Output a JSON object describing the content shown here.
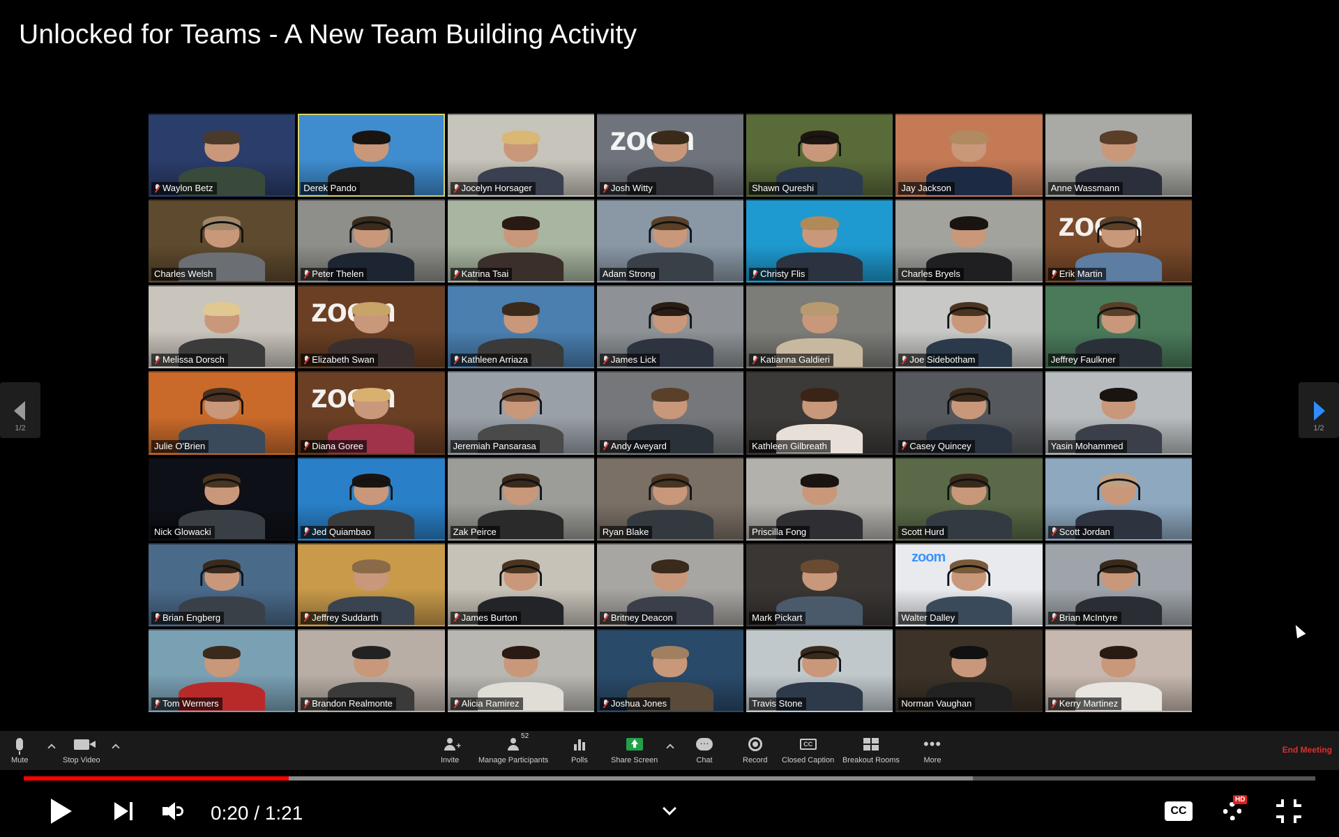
{
  "video": {
    "title": "Unlocked for Teams - A New Team Building Activity"
  },
  "gallery": {
    "participants": [
      {
        "name": "Waylon Betz",
        "muted": true,
        "bg": "#2b3d6b",
        "shirt": "#3a4a3a",
        "hair": "#4a3a2a",
        "headset": false
      },
      {
        "name": "Derek Pando",
        "muted": false,
        "bg": "#3f8ccf",
        "shirt": "#222222",
        "hair": "#1a1410",
        "headset": false,
        "active": true
      },
      {
        "name": "Jocelyn Horsager",
        "muted": true,
        "bg": "#c7c4bb",
        "shirt": "#3a4050",
        "hair": "#d9b774",
        "headset": false
      },
      {
        "name": "Josh Witty",
        "muted": true,
        "bg": "#6f747c",
        "shirt": "#2e3036",
        "hair": "#3a2a1a",
        "headset": false,
        "zoom_text": "zoom"
      },
      {
        "name": "Shawn Qureshi",
        "muted": false,
        "bg": "#5a6b3a",
        "shirt": "#2b3a4f",
        "hair": "#1f1510",
        "headset": true
      },
      {
        "name": "Jay Jackson",
        "muted": false,
        "bg": "#c47a55",
        "shirt": "#1d2a44",
        "hair": "#b08a60",
        "headset": false
      },
      {
        "name": "Anne Wassmann",
        "muted": false,
        "bg": "#a9aaa5",
        "shirt": "#2a2f3b",
        "hair": "#5a3e28",
        "headset": false
      },
      {
        "name": "Charles Welsh",
        "muted": false,
        "bg": "#5e4a2e",
        "shirt": "#6b6e72",
        "hair": "#a08768",
        "headset": true
      },
      {
        "name": "Peter Thelen",
        "muted": true,
        "bg": "#8e8e8a",
        "shirt": "#1d2533",
        "hair": "#3a2b1c",
        "headset": true
      },
      {
        "name": "Katrina Tsai",
        "muted": true,
        "bg": "#a8b5a0",
        "shirt": "#3a2f2a",
        "hair": "#2a1a14",
        "headset": false
      },
      {
        "name": "Adam Strong",
        "muted": false,
        "bg": "#8a98a6",
        "shirt": "#3a4048",
        "hair": "#5a4028",
        "headset": true
      },
      {
        "name": "Christy Flis",
        "muted": true,
        "bg": "#1e9ad0",
        "shirt": "#2b3340",
        "hair": "#b08a58",
        "headset": false
      },
      {
        "name": "Charles Bryels",
        "muted": false,
        "bg": "#a3a39e",
        "shirt": "#1f1f22",
        "hair": "#1a1410",
        "headset": false
      },
      {
        "name": "Erik Martin",
        "muted": true,
        "bg": "#7a4a2a",
        "shirt": "#5d7da3",
        "hair": "#5a4028",
        "headset": true,
        "zoom_text": "zoom"
      },
      {
        "name": "Melissa Dorsch",
        "muted": true,
        "bg": "#c9c4bc",
        "shirt": "#3b3b3b",
        "hair": "#e0c890",
        "headset": false
      },
      {
        "name": "Elizabeth Swan",
        "muted": true,
        "bg": "#6a3f24",
        "shirt": "#3a2f2f",
        "hair": "#c9a468",
        "headset": false,
        "zoom_text": "zoom"
      },
      {
        "name": "Kathleen Arriaza",
        "muted": true,
        "bg": "#4a7fb0",
        "shirt": "#3a3a3a",
        "hair": "#3a2a1c",
        "headset": false
      },
      {
        "name": "James Lick",
        "muted": true,
        "bg": "#8e9296",
        "shirt": "#2d3440",
        "hair": "#2a1d14",
        "headset": true
      },
      {
        "name": "Katianna Galdieri",
        "muted": true,
        "bg": "#7c7c78",
        "shirt": "#c8b8a0",
        "hair": "#b89a70",
        "headset": false
      },
      {
        "name": "Joe Sidebotham",
        "muted": true,
        "bg": "#c8c8c6",
        "shirt": "#2a3a4a",
        "hair": "#4a3520",
        "headset": true
      },
      {
        "name": "Jeffrey Faulkner",
        "muted": false,
        "bg": "#4a7a5a",
        "shirt": "#2a3038",
        "hair": "#5a4028",
        "headset": true
      },
      {
        "name": "Julie O'Brien",
        "muted": false,
        "bg": "#c96a2a",
        "shirt": "#3a4a5a",
        "hair": "#4a3020",
        "headset": true
      },
      {
        "name": "Diana Goree",
        "muted": true,
        "bg": "#6a3f24",
        "shirt": "#a0324a",
        "hair": "#d8b070",
        "headset": false,
        "zoom_text": "zoom"
      },
      {
        "name": "Jeremiah Pansarasa",
        "muted": false,
        "bg": "#9aa0a8",
        "shirt": "#4a4a4a",
        "hair": "#6a4a30",
        "headset": true
      },
      {
        "name": "Andy Aveyard",
        "muted": true,
        "bg": "#75777a",
        "shirt": "#2b3138",
        "hair": "#5a4028",
        "headset": false
      },
      {
        "name": "Kathleen Gilbreath",
        "muted": false,
        "bg": "#3c3a38",
        "shirt": "#e8e0d8",
        "hair": "#3a2416",
        "headset": false
      },
      {
        "name": "Casey Quincey",
        "muted": true,
        "bg": "#55585c",
        "shirt": "#2a3440",
        "hair": "#3a2a1c",
        "headset": true
      },
      {
        "name": "Yasin Mohammed",
        "muted": false,
        "bg": "#b8bcbe",
        "shirt": "#3a3f4a",
        "hair": "#1a1410",
        "headset": false
      },
      {
        "name": "Nick Glowacki",
        "muted": false,
        "bg": "#0e1018",
        "shirt": "#3a3f46",
        "hair": "#4a3520",
        "headset": true
      },
      {
        "name": "Jed Quiambao",
        "muted": true,
        "bg": "#2a80c8",
        "shirt": "#3a3a3a",
        "hair": "#1a1410",
        "headset": true
      },
      {
        "name": "Zak Peirce",
        "muted": false,
        "bg": "#9c9c98",
        "shirt": "#2a2a2a",
        "hair": "#3a2a1c",
        "headset": true
      },
      {
        "name": "Ryan Blake",
        "muted": false,
        "bg": "#7b7066",
        "shirt": "#33393f",
        "hair": "#4a3520",
        "headset": true
      },
      {
        "name": "Priscilla Fong",
        "muted": false,
        "bg": "#b3b1ac",
        "shirt": "#2f2f33",
        "hair": "#1a1410",
        "headset": false
      },
      {
        "name": "Scott Hurd",
        "muted": false,
        "bg": "#5a6a48",
        "shirt": "#333a42",
        "hair": "#3a2a1c",
        "headset": true
      },
      {
        "name": "Scott Jordan",
        "muted": true,
        "bg": "#8ea8c0",
        "shirt": "#2d3440",
        "hair": "#c0a080",
        "headset": true
      },
      {
        "name": "Brian Engberg",
        "muted": true,
        "bg": "#4a6a8a",
        "shirt": "#3a4048",
        "hair": "#3a2a1c",
        "headset": true
      },
      {
        "name": "Jeffrey Suddarth",
        "muted": true,
        "bg": "#c89a4a",
        "shirt": "#3a4450",
        "hair": "#8a6a48",
        "headset": false
      },
      {
        "name": "James Burton",
        "muted": true,
        "bg": "#c7c2b8",
        "shirt": "#222428",
        "hair": "#4a3520",
        "headset": true
      },
      {
        "name": "Britney Deacon",
        "muted": true,
        "bg": "#a8a6a2",
        "shirt": "#3a3f4a",
        "hair": "#3a2a1c",
        "headset": false
      },
      {
        "name": "Mark Pickart",
        "muted": false,
        "bg": "#3a3634",
        "shirt": "#4a5a6a",
        "hair": "#6a4a30",
        "headset": false
      },
      {
        "name": "Walter Dalley",
        "muted": false,
        "bg": "#e8eaee",
        "shirt": "#3a4a5a",
        "hair": "#7a5a38",
        "headset": true,
        "zoom_text_small": "zoom"
      },
      {
        "name": "Brian McIntyre",
        "muted": true,
        "bg": "#9ea4aa",
        "shirt": "#2a2e34",
        "hair": "#3a2a1c",
        "headset": true
      },
      {
        "name": "Tom Wermers",
        "muted": true,
        "bg": "#7aa0b4",
        "shirt": "#b82a2a",
        "hair": "#3a2a1c",
        "headset": false
      },
      {
        "name": "Brandon Realmonte",
        "muted": true,
        "bg": "#b8aea6",
        "shirt": "#3a3a3a",
        "hair": "#222222",
        "headset": false
      },
      {
        "name": "Alicia Ramirez",
        "muted": true,
        "bg": "#b9b7b2",
        "shirt": "#e0dcd6",
        "hair": "#2a1a14",
        "headset": false
      },
      {
        "name": "Joshua Jones",
        "muted": true,
        "bg": "#2a4a6a",
        "shirt": "#5a4a3a",
        "hair": "#a08060",
        "headset": false
      },
      {
        "name": "Travis Stone",
        "muted": false,
        "bg": "#c0c8cc",
        "shirt": "#2e3a4a",
        "hair": "#3a2a1c",
        "headset": true
      },
      {
        "name": "Norman Vaughan",
        "muted": false,
        "bg": "#3c3228",
        "shirt": "#222222",
        "hair": "#111111",
        "headset": false
      },
      {
        "name": "Kerry Martinez",
        "muted": true,
        "bg": "#c6b8ae",
        "shirt": "#e8e4e0",
        "hair": "#2a1a14",
        "headset": false
      }
    ]
  },
  "pager": {
    "left_page": "1/2",
    "right_page": "1/2"
  },
  "zoom_toolbar": {
    "mute_label": "Mute",
    "stop_video_label": "Stop Video",
    "invite_label": "Invite",
    "manage_participants_label": "Manage Participants",
    "participant_count": "52",
    "polls_label": "Polls",
    "share_screen_label": "Share Screen",
    "chat_label": "Chat",
    "record_label": "Record",
    "closed_caption_label": "Closed Caption",
    "closed_caption_icon_text": "CC",
    "breakout_rooms_label": "Breakout Rooms",
    "more_label": "More",
    "more_icon_text": "•••",
    "end_meeting_label": "End Meeting"
  },
  "player": {
    "current_time": "0:20",
    "duration": "1:21",
    "time_display": "0:20 / 1:21",
    "played_fraction": 0.205,
    "buffered_fraction": 0.735,
    "cc_label": "CC",
    "hd_badge": "HD",
    "accent_color": "#ff0000"
  }
}
